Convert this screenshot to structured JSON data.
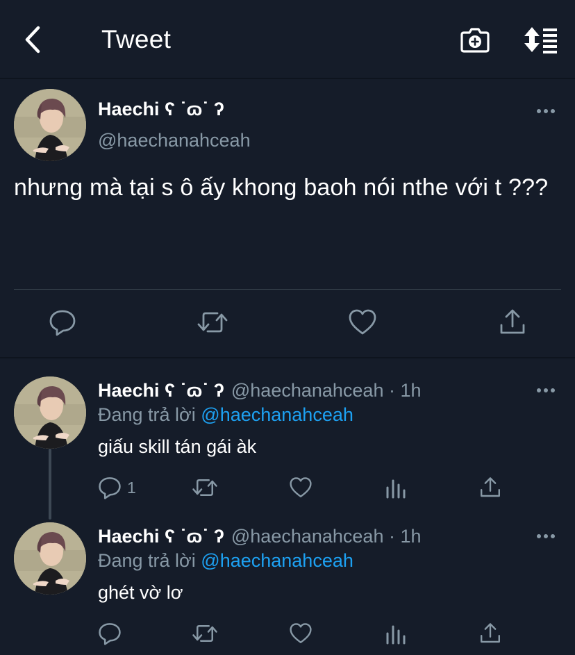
{
  "header": {
    "title": "Tweet",
    "back_icon": "chevron-left-icon",
    "camera_icon": "camera-plus-icon",
    "sort_icon": "sort-icon"
  },
  "main_tweet": {
    "display_name": "Haechi ʕ ˙ɷ˙ ʔ",
    "handle": "@haechanahceah",
    "text": "nhưng mà tại s ô ấy khong baoh nói nthe với t ???",
    "actions": [
      "reply-icon",
      "retweet-icon",
      "like-icon",
      "share-icon"
    ]
  },
  "replies": [
    {
      "display_name": "Haechi ʕ ˙ɷ˙ ʔ",
      "handle": "@haechanahceah",
      "time": "· 1h",
      "replying_prefix": "Đang trả lời",
      "replying_to": "@haechanahceah",
      "text": "giấu skill tán gái àk",
      "reply_count": "1"
    },
    {
      "display_name": "Haechi ʕ ˙ɷ˙ ʔ",
      "handle": "@haechanahceah",
      "time": "· 1h",
      "replying_prefix": "Đang trả lời",
      "replying_to": "@haechanahceah",
      "text": "ghét vờ lơ",
      "reply_count": ""
    }
  ],
  "colors": {
    "background": "#151c29",
    "secondary_text": "#8899a6",
    "link": "#1da1f2",
    "divider": "#38444d"
  }
}
